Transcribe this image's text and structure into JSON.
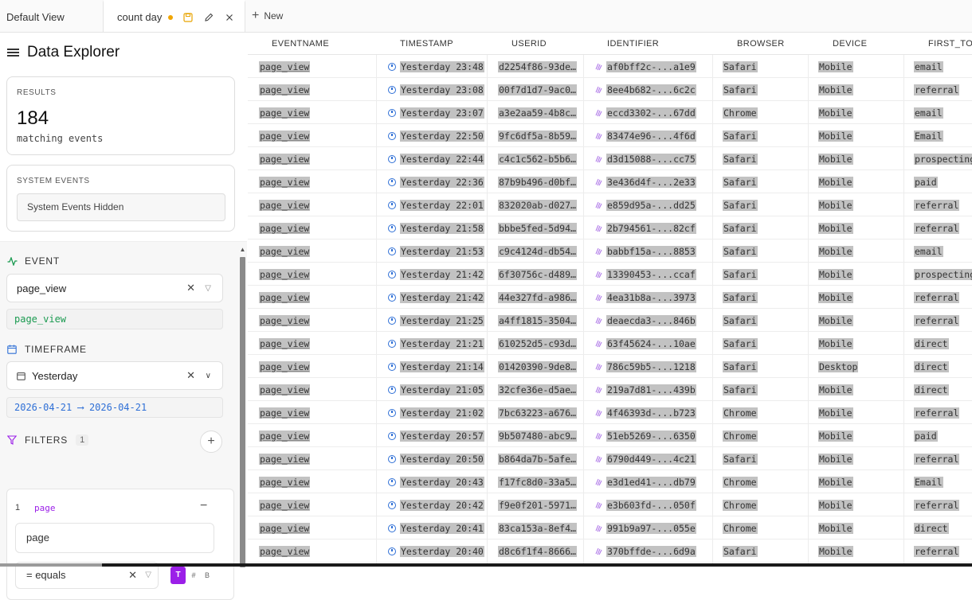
{
  "tabs": {
    "default_label": "Default View",
    "active_label": "count day",
    "new_label": "New"
  },
  "sidebar": {
    "title": "Data Explorer",
    "results": {
      "label": "RESULTS",
      "count": "184",
      "sub": "matching events"
    },
    "system_events": {
      "label": "SYSTEM EVENTS",
      "value": "System Events Hidden"
    },
    "event": {
      "heading": "EVENT",
      "selected": "page_view",
      "pill": "page_view"
    },
    "timeframe": {
      "heading": "TIMEFRAME",
      "selected": "Yesterday",
      "range_start": "2026-04-21",
      "arrow": "⟶",
      "range_end": "2026-04-21"
    },
    "filters": {
      "heading": "FILTERS",
      "count": "1",
      "item": {
        "index": "1",
        "key": "page",
        "field_value": "page",
        "operator": "= equals",
        "type_t": "T",
        "type_hash": "#",
        "type_b": "B"
      }
    }
  },
  "table": {
    "columns": [
      "EVENTNAME",
      "TIMESTAMP",
      "USERID",
      "IDENTIFIER",
      "BROWSER",
      "DEVICE",
      "FIRST_TOUC"
    ],
    "rows": [
      [
        "page_view",
        "Yesterday 23:48",
        "d2254f86-93de…",
        "af0bff2c-...a1e9",
        "Safari",
        "Mobile",
        "email"
      ],
      [
        "page_view",
        "Yesterday 23:08",
        "00f7d1d7-9ac0…",
        "8ee4b682-...6c2c",
        "Safari",
        "Mobile",
        "referral"
      ],
      [
        "page_view",
        "Yesterday 23:07",
        "a3e2aa59-4b8c…",
        "eccd3302-...67dd",
        "Chrome",
        "Mobile",
        "email"
      ],
      [
        "page_view",
        "Yesterday 22:50",
        "9fc6df5a-8b59…",
        "83474e96-...4f6d",
        "Safari",
        "Mobile",
        "Email"
      ],
      [
        "page_view",
        "Yesterday 22:44",
        "c4c1c562-b5b6…",
        "d3d15088-...cc75",
        "Safari",
        "Mobile",
        "prospecting"
      ],
      [
        "page_view",
        "Yesterday 22:36",
        "87b9b496-d0bf…",
        "3e436d4f-...2e33",
        "Safari",
        "Mobile",
        "paid"
      ],
      [
        "page_view",
        "Yesterday 22:01",
        "832020ab-d027…",
        "e859d95a-...dd25",
        "Safari",
        "Mobile",
        "referral"
      ],
      [
        "page_view",
        "Yesterday 21:58",
        "bbbe5fed-5d94…",
        "2b794561-...82cf",
        "Safari",
        "Mobile",
        "referral"
      ],
      [
        "page_view",
        "Yesterday 21:53",
        "c9c4124d-db54…",
        "babbf15a-...8853",
        "Safari",
        "Mobile",
        "email"
      ],
      [
        "page_view",
        "Yesterday 21:42",
        "6f30756c-d489…",
        "13390453-...ccaf",
        "Safari",
        "Mobile",
        "prospecting"
      ],
      [
        "page_view",
        "Yesterday 21:42",
        "44e327fd-a986…",
        "4ea31b8a-...3973",
        "Safari",
        "Mobile",
        "referral"
      ],
      [
        "page_view",
        "Yesterday 21:25",
        "a4ff1815-3504…",
        "deaecda3-...846b",
        "Safari",
        "Mobile",
        "referral"
      ],
      [
        "page_view",
        "Yesterday 21:21",
        "610252d5-c93d…",
        "63f45624-...10ae",
        "Safari",
        "Mobile",
        "direct"
      ],
      [
        "page_view",
        "Yesterday 21:14",
        "01420390-9de8…",
        "786c59b5-...1218",
        "Safari",
        "Desktop",
        "direct"
      ],
      [
        "page_view",
        "Yesterday 21:05",
        "32cfe36e-d5ae…",
        "219a7d81-...439b",
        "Safari",
        "Mobile",
        "direct"
      ],
      [
        "page_view",
        "Yesterday 21:02",
        "7bc63223-a676…",
        "4f46393d-...b723",
        "Chrome",
        "Mobile",
        "referral"
      ],
      [
        "page_view",
        "Yesterday 20:57",
        "9b507480-abc9…",
        "51eb5269-...6350",
        "Chrome",
        "Mobile",
        "paid"
      ],
      [
        "page_view",
        "Yesterday 20:50",
        "b864da7b-5afe…",
        "6790d449-...4c21",
        "Safari",
        "Mobile",
        "referral"
      ],
      [
        "page_view",
        "Yesterday 20:43",
        "f17fc8d0-33a5…",
        "e3d1ed41-...db79",
        "Chrome",
        "Mobile",
        "Email"
      ],
      [
        "page_view",
        "Yesterday 20:42",
        "f9e0f201-5971…",
        "e3b603fd-...050f",
        "Chrome",
        "Mobile",
        "referral"
      ],
      [
        "page_view",
        "Yesterday 20:41",
        "83ca153a-8ef4…",
        "991b9a97-...055e",
        "Chrome",
        "Mobile",
        "direct"
      ],
      [
        "page_view",
        "Yesterday 20:40",
        "d8c6f1f4-8666…",
        "370bffde-...6d9a",
        "Safari",
        "Mobile",
        "referral"
      ]
    ]
  },
  "colors": {
    "accent_purple": "#9b1fe8",
    "accent_green": "#1a9a50",
    "accent_blue": "#2e6fd6",
    "highlight": "#c2c2c2"
  }
}
